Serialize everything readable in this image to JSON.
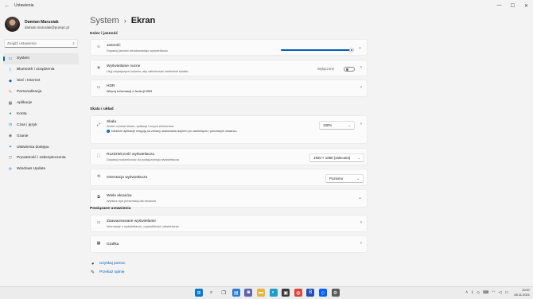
{
  "window": {
    "app_title": "Ustawienia",
    "controls": [
      "minimize",
      "maximize",
      "close"
    ]
  },
  "profile": {
    "name": "Damian Marusiak",
    "email": "damian.marusiak@purepc.pl"
  },
  "search": {
    "placeholder": "Znajdź ustawienie"
  },
  "sidebar": {
    "items": [
      {
        "label": "System",
        "icon": "monitor-icon",
        "color": "#0067c0",
        "active": true
      },
      {
        "label": "Bluetooth i urządzenia",
        "icon": "bluetooth-icon",
        "color": "#0078d4"
      },
      {
        "label": "Sieć i Internet",
        "icon": "wifi-icon",
        "color": "#005fb8"
      },
      {
        "label": "Personalizacja",
        "icon": "brush-icon",
        "color": "#c87b2a"
      },
      {
        "label": "Aplikacje",
        "icon": "apps-icon",
        "color": "#5a5a5a"
      },
      {
        "label": "Konta",
        "icon": "person-icon",
        "color": "#1aa260"
      },
      {
        "label": "Czas i język",
        "icon": "clock-globe-icon",
        "color": "#0078d4"
      },
      {
        "label": "Granie",
        "icon": "gamepad-icon",
        "color": "#6b6b6b"
      },
      {
        "label": "Ułatwienia dostępu",
        "icon": "accessibility-icon",
        "color": "#3b6fd6"
      },
      {
        "label": "Prywatność i zabezpieczenia",
        "icon": "shield-icon",
        "color": "#6b6b6b"
      },
      {
        "label": "Windows Update",
        "icon": "update-icon",
        "color": "#0078d4"
      }
    ]
  },
  "breadcrumb": {
    "parent": "System",
    "separator": "›",
    "current": "Ekran"
  },
  "sections": {
    "color": "Kolor i jasność",
    "scale": "Skala i układ",
    "related": "Powiązane ustawienia"
  },
  "brightness": {
    "title": "Jasność",
    "subtitle": "Dopasuj jasność wbudowanego wyświetlacza",
    "level_percent": 100
  },
  "night_light": {
    "title": "Wyświetlanie nocne",
    "subtitle": "Użyj cieplejszych kolorów, aby zablokować niebieskie światło",
    "state_label": "Wyłączone",
    "on": false
  },
  "hdr": {
    "title": "HDR",
    "link": "Więcej informacji o funkcji HDR"
  },
  "scale": {
    "title": "Skala",
    "subtitle": "Zmień rozmiar tekstu, aplikacji i innych elementów",
    "value": "100%",
    "notice": "Niektóre aplikacje reagują na zmiany skalowania dopiero po zamknięciu i ponownym otwarciu."
  },
  "resolution": {
    "title": "Rozdzielczość wyświetlacza",
    "subtitle": "Dopasuj rozdzielczość do podłączonego wyświetlacza",
    "value": "1920 × 1080 (zalecana)"
  },
  "orientation": {
    "title": "Orientacja wyświetlacza",
    "value": "Poziomo"
  },
  "multiple": {
    "title": "Wiele ekranów",
    "subtitle": "Wybierz tryb prezentacji dla ekranów"
  },
  "advanced": {
    "title": "Zaawansowane wyświetlanie",
    "subtitle": "Informacje o wyświetlaczu, częstotliwość odświeżania"
  },
  "graphics": {
    "title": "Grafika"
  },
  "help": {
    "get_help": "Uzyskaj pomoc",
    "feedback": "Przekaż opinię"
  },
  "taskbar": {
    "apps": [
      {
        "icon": "windows-start-icon",
        "color": "#0078d4"
      },
      {
        "icon": "search-icon",
        "color": "#333333"
      },
      {
        "icon": "task-view-icon",
        "color": "#333333"
      },
      {
        "icon": "widgets-icon",
        "color": "#2b7cd3"
      },
      {
        "icon": "chat-icon",
        "color": "#6264a7"
      },
      {
        "icon": "file-explorer-icon",
        "color": "#e8b33e"
      },
      {
        "icon": "edge-icon",
        "color": "#1f9cce"
      },
      {
        "icon": "store-icon",
        "color": "#3a3a3a"
      },
      {
        "icon": "chrome-icon",
        "color": "#db4437"
      },
      {
        "icon": "brave-icon",
        "color": "#1e4fb5"
      },
      {
        "icon": "dropbox-icon",
        "color": "#0061fe"
      },
      {
        "icon": "settings-icon",
        "color": "#5a5a5a"
      }
    ],
    "time": "10:57",
    "date": "28.11.2021"
  }
}
